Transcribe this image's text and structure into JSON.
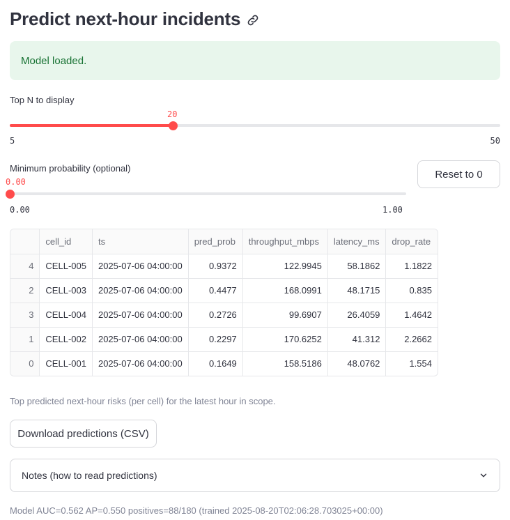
{
  "header": {
    "title": "Predict next-hour incidents",
    "link_icon": "link-icon"
  },
  "alert": {
    "message": "Model loaded."
  },
  "top_n_slider": {
    "label": "Top N to display",
    "value": "20",
    "min": "5",
    "max": "50",
    "fraction": 0.3333
  },
  "min_prob_slider": {
    "label": "Minimum probability (optional)",
    "value": "0.00",
    "min": "0.00",
    "max": "1.00",
    "fraction": 0.0
  },
  "reset_button": {
    "label": "Reset to 0"
  },
  "table": {
    "columns": [
      "",
      "cell_id",
      "ts",
      "pred_prob",
      "throughput_mbps",
      "latency_ms",
      "drop_rate"
    ],
    "rows": [
      [
        "4",
        "CELL-005",
        "2025-07-06 04:00:00",
        "0.9372",
        "122.9945",
        "58.1862",
        "1.1822"
      ],
      [
        "2",
        "CELL-003",
        "2025-07-06 04:00:00",
        "0.4477",
        "168.0991",
        "48.1715",
        "0.835"
      ],
      [
        "3",
        "CELL-004",
        "2025-07-06 04:00:00",
        "0.2726",
        "99.6907",
        "26.4059",
        "1.4642"
      ],
      [
        "1",
        "CELL-002",
        "2025-07-06 04:00:00",
        "0.2297",
        "170.6252",
        "41.312",
        "2.2662"
      ],
      [
        "0",
        "CELL-001",
        "2025-07-06 04:00:00",
        "0.1649",
        "158.5186",
        "48.0762",
        "1.554"
      ]
    ]
  },
  "caption": "Top predicted next-hour risks (per cell) for the latest hour in scope.",
  "download_button": {
    "label": "Download predictions (CSV)"
  },
  "expander": {
    "label": "Notes (how to read predictions)",
    "icon": "chevron-down-icon"
  },
  "footer": {
    "text": "Model AUC=0.562 AP=0.550 positives=88/180 (trained 2025-08-20T02:06:28.703025+00:00)"
  },
  "colors": {
    "accent": "#ff4b4b",
    "success_bg": "#e8f6ec",
    "success_text": "#177233"
  }
}
